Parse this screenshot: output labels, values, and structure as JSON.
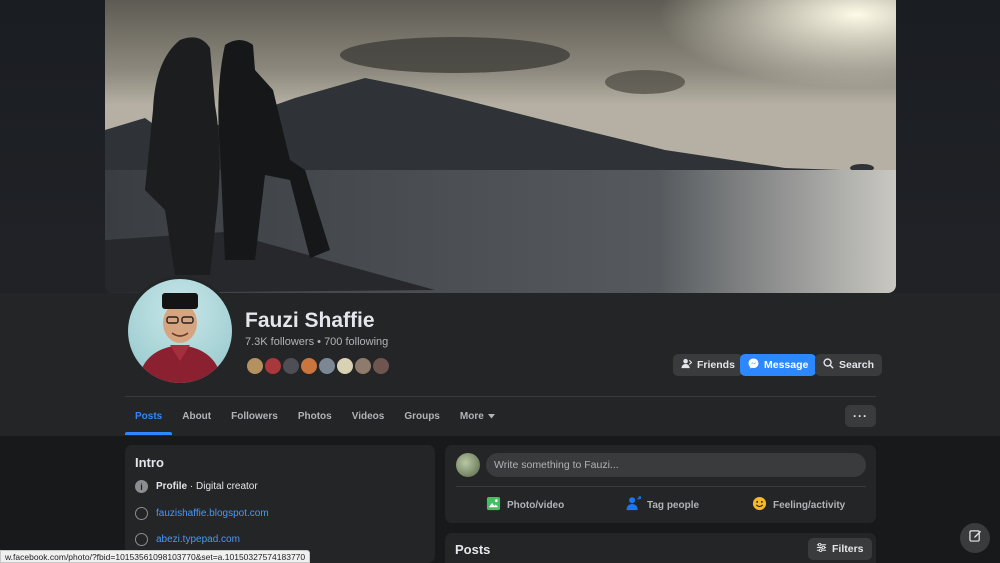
{
  "profile": {
    "name": "Fauzi Shaffie",
    "followers": "7.3K followers",
    "separator": " • ",
    "following": "700 following"
  },
  "header_buttons": {
    "friends": "Friends",
    "message": "Message",
    "search": "Search"
  },
  "tabs": [
    {
      "label": "Posts",
      "active": true
    },
    {
      "label": "About"
    },
    {
      "label": "Followers"
    },
    {
      "label": "Photos"
    },
    {
      "label": "Videos"
    },
    {
      "label": "Groups"
    },
    {
      "label": "More"
    }
  ],
  "tabs_more_icon": "···",
  "intro": {
    "title": "Intro",
    "profile_label": "Profile",
    "profile_value": " · Digital creator",
    "links": [
      "fauzishaffie.blogspot.com",
      "abezi.typepad.com"
    ]
  },
  "composer": {
    "placeholder": "Write something to Fauzi...",
    "actions": [
      "Photo/video",
      "Tag people",
      "Feeling/activity"
    ]
  },
  "posts": {
    "title": "Posts",
    "filters": "Filters"
  },
  "status_bar": "w.facebook.com/photo/?fbid=10153561098103770&set=a.10150327574183770",
  "colors": {
    "accent": "#2d88ff",
    "bg": "#18191a",
    "card": "#242526"
  },
  "icons": [
    "friends-icon",
    "messenger-icon",
    "search-icon",
    "info-icon",
    "globe-icon",
    "photo-icon",
    "tag-icon",
    "feeling-icon",
    "filters-icon",
    "edit-icon"
  ]
}
